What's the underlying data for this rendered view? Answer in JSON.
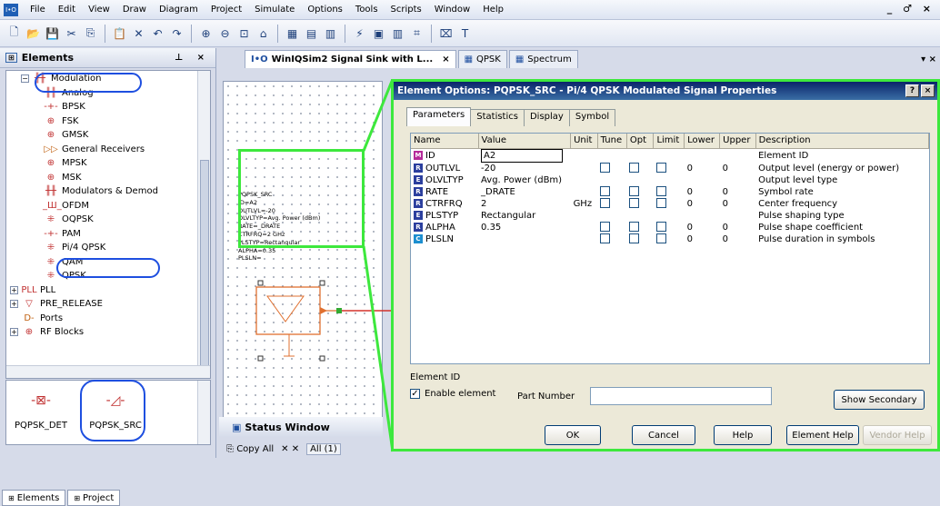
{
  "menubar": {
    "app_icon": "I•O",
    "items": [
      "File",
      "Edit",
      "View",
      "Draw",
      "Diagram",
      "Project",
      "Simulate",
      "Options",
      "Tools",
      "Scripts",
      "Window",
      "Help"
    ],
    "controls": "_ ♂ ×"
  },
  "toolbar": {
    "icons": [
      "new-doc-icon",
      "open-folder-icon",
      "save-icon",
      "cut-icon",
      "copy-icon",
      "paste-icon",
      "delete-icon",
      "undo-icon",
      "redo-icon",
      "zoom-in-icon",
      "zoom-out-icon",
      "zoom-fit-icon",
      "schematic-icon",
      "layout-icon",
      "graph-icon",
      "system-icon",
      "run-icon",
      "tune-icon",
      "optimize-icon",
      "measure-icon",
      "element-icon",
      "text-icon"
    ],
    "glyphs": [
      "🗋",
      "📂",
      "💾",
      "✂",
      "⎘",
      "📋",
      "✕",
      "↶",
      "↷",
      "⊕",
      "⊖",
      "⊡",
      "⌂",
      "▦",
      "▤",
      "▥",
      "⚡",
      "▣",
      "▥",
      "⌗",
      "⌧",
      "T"
    ]
  },
  "elements_panel": {
    "title": "Elements",
    "pin": "⊥ ×",
    "tree": [
      {
        "label": "Modulation",
        "indent": 1,
        "expander": "⊟",
        "icon": "╫╫"
      },
      {
        "label": "Analog",
        "indent": 3,
        "icon": "╫╫"
      },
      {
        "label": "BPSK",
        "indent": 3,
        "icon": "-+-"
      },
      {
        "label": "FSK",
        "indent": 3,
        "icon": "⊕"
      },
      {
        "label": "GMSK",
        "indent": 3,
        "icon": "⊕"
      },
      {
        "label": "General Receivers",
        "indent": 3,
        "icon": "▷▷"
      },
      {
        "label": "MPSK",
        "indent": 3,
        "icon": "⊕"
      },
      {
        "label": "MSK",
        "indent": 3,
        "icon": "⊕"
      },
      {
        "label": "Modulators & Demod",
        "indent": 3,
        "icon": "╫╫"
      },
      {
        "label": "OFDM",
        "indent": 3,
        "icon": "_Ш_"
      },
      {
        "label": "OQPSK",
        "indent": 3,
        "icon": "⁜"
      },
      {
        "label": "PAM",
        "indent": 3,
        "icon": "-+-"
      },
      {
        "label": "Pi/4 QPSK",
        "indent": 3,
        "icon": "⁜"
      },
      {
        "label": "QAM",
        "indent": 3,
        "icon": "⁜"
      },
      {
        "label": "QPSK",
        "indent": 3,
        "icon": "⁜"
      },
      {
        "label": "PLL",
        "indent": 0,
        "expander": "⊞",
        "icon": "PLL"
      },
      {
        "label": "PRE_RELEASE",
        "indent": 0,
        "expander": "⊞",
        "icon": "▽"
      },
      {
        "label": "Ports",
        "indent": 1,
        "icon": "D-"
      },
      {
        "label": "RF Blocks",
        "indent": 0,
        "expander": "⊞",
        "icon": "⊕"
      }
    ],
    "strip_elements": [
      "PQPSK_DET",
      "PQPSK_SRC"
    ],
    "bottom_tabs": [
      "Elements",
      "Project"
    ]
  },
  "doc_tabs": [
    {
      "label": "WinIQSim2 Signal Sink with L...",
      "active": true,
      "closable": true
    },
    {
      "label": "QPSK",
      "active": false
    },
    {
      "label": "Spectrum",
      "active": false
    }
  ],
  "doc_tabs_close": "▾ ×",
  "schematic": {
    "element_text": "PQPSK_SRC\nID=A2\nOUTLVL=-20\nOLVLTYP=Avg. Power (dBm)\nRATE=_DRATE\nCTRFRQ=2 GHz\nPLSTYP=Rectangular\nALPHA=0.35\nPLSLN="
  },
  "status": {
    "title": "Status Window",
    "copy_all": "Copy All",
    "all_label": "All (1)"
  },
  "dialog": {
    "title": "Element Options: PQPSK_SRC - Pi/4 QPSK Modulated Signal Properties",
    "help": "?",
    "close": "×",
    "tabs": [
      "Parameters",
      "Statistics",
      "Display",
      "Symbol"
    ],
    "columns": [
      "Name",
      "Value",
      "Unit",
      "Tune",
      "Opt",
      "Limit",
      "Lower",
      "Upper",
      "Description"
    ],
    "rows": [
      {
        "badge": "M",
        "badge_color": "#b52a9a",
        "name": "ID",
        "value": "A2",
        "unit": "",
        "checks": false,
        "lower": "",
        "upper": "",
        "description": "Element ID"
      },
      {
        "badge": "R",
        "badge_color": "#2b3f9e",
        "name": "OUTLVL",
        "value": "-20",
        "unit": "",
        "checks": true,
        "lower": "0",
        "upper": "0",
        "description": "Output level (energy or power)"
      },
      {
        "badge": "E",
        "badge_color": "#2b3f9e",
        "name": "OLVLTYP",
        "value": "Avg. Power (dBm)",
        "unit": "",
        "checks": false,
        "lower": "",
        "upper": "",
        "description": "Output level type"
      },
      {
        "badge": "R",
        "badge_color": "#2b3f9e",
        "name": "RATE",
        "value": "_DRATE",
        "unit": "",
        "checks": true,
        "lower": "0",
        "upper": "0",
        "description": "Symbol rate"
      },
      {
        "badge": "R",
        "badge_color": "#2b3f9e",
        "name": "CTRFRQ",
        "value": "2",
        "unit": "GHz",
        "checks": true,
        "lower": "0",
        "upper": "0",
        "description": "Center frequency"
      },
      {
        "badge": "E",
        "badge_color": "#2b3f9e",
        "name": "PLSTYP",
        "value": "Rectangular",
        "unit": "",
        "checks": false,
        "lower": "",
        "upper": "",
        "description": "Pulse shaping type"
      },
      {
        "badge": "R",
        "badge_color": "#2b3f9e",
        "name": "ALPHA",
        "value": "0.35",
        "unit": "",
        "checks": true,
        "lower": "0",
        "upper": "0",
        "description": "Pulse shape coefficient"
      },
      {
        "badge": "C",
        "badge_color": "#1d8fd0",
        "name": "PLSLN",
        "value": "",
        "unit": "",
        "checks": true,
        "lower": "0",
        "upper": "0",
        "description": "Pulse duration in symbols"
      }
    ],
    "element_id_label": "Element ID",
    "enable_element": "Enable element",
    "part_number_label": "Part Number",
    "part_number_value": "",
    "show_secondary": "Show Secondary",
    "buttons": {
      "ok": "OK",
      "cancel": "Cancel",
      "help": "Help",
      "element_help": "Element Help",
      "vendor_help": "Vendor Help"
    }
  }
}
